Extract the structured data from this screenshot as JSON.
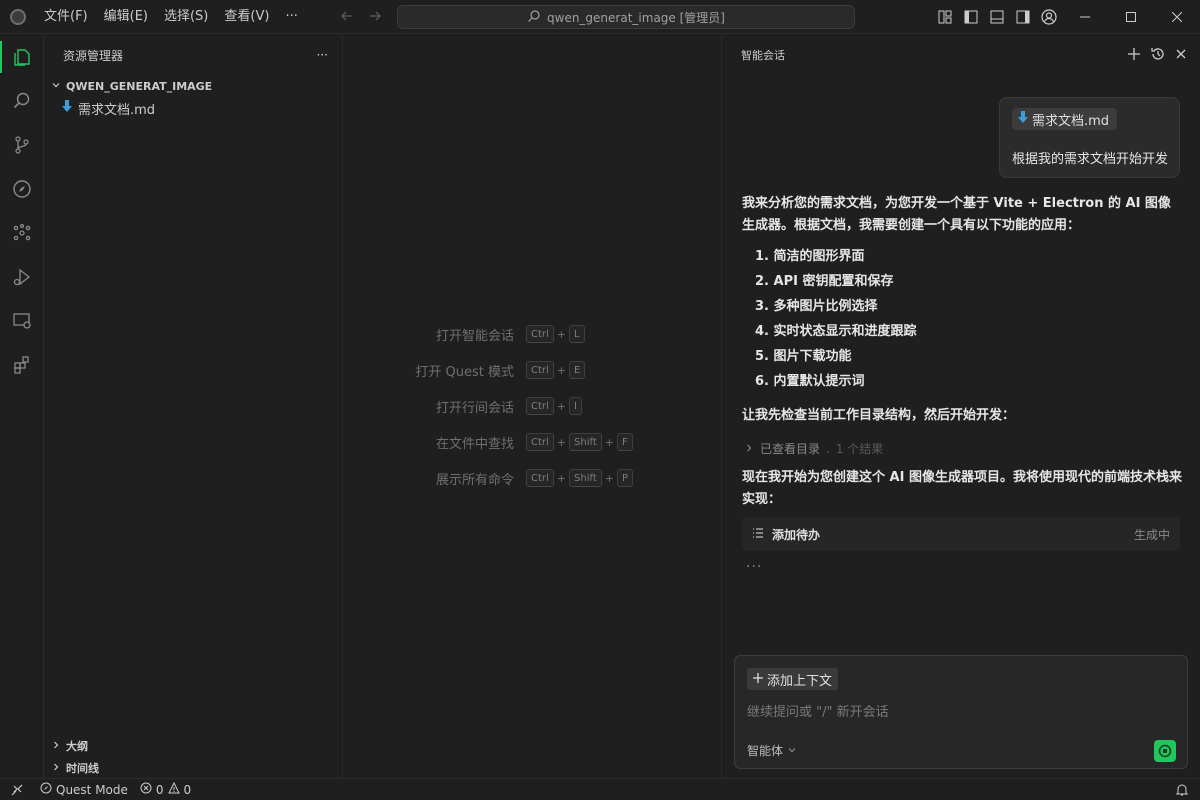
{
  "menu": [
    "文件(F)",
    "编辑(E)",
    "选择(S)",
    "查看(V)",
    "···"
  ],
  "search": {
    "text": "qwen_generat_image [管理员]"
  },
  "sidebar": {
    "title": "资源管理器",
    "more": "···",
    "folder": "QWEN_GENERAT_IMAGE",
    "files": [
      {
        "name": "需求文档.md"
      }
    ],
    "sections": [
      "大纲",
      "时间线"
    ]
  },
  "editor": {
    "shortcuts": [
      {
        "label": "打开智能会话",
        "keys": [
          "Ctrl",
          "L"
        ]
      },
      {
        "label": "打开 Quest 模式",
        "keys": [
          "Ctrl",
          "E"
        ]
      },
      {
        "label": "打开行间会话",
        "keys": [
          "Ctrl",
          "I"
        ]
      },
      {
        "label": "在文件中查找",
        "keys": [
          "Ctrl",
          "Shift",
          "F"
        ]
      },
      {
        "label": "展示所有命令",
        "keys": [
          "Ctrl",
          "Shift",
          "P"
        ]
      }
    ]
  },
  "chat": {
    "title": "智能会话",
    "user_message": {
      "file_chip": "需求文档.md",
      "text": "根据我的需求文档开始开发"
    },
    "reply_intro": "我来分析您的需求文档，为您开发一个基于 Vite + Electron 的 AI 图像生成器。根据文档，我需要创建一个具有以下功能的应用：",
    "features": [
      "1. 简洁的图形界面",
      "2. API 密钥配置和保存",
      "3. 多种图片比例选择",
      "4. 实时状态显示和进度跟踪",
      "5. 图片下载功能",
      "6. 内置默认提示词"
    ],
    "check_text": "让我先检查当前工作目录结构，然后开始开发：",
    "tool": {
      "label": "已查看目录",
      "sep": ".",
      "result": "1 个结果"
    },
    "plan_text": "现在我开始为您创建这个 AI 图像生成器项目。我将使用现代的前端技术栈来实现：",
    "todo": {
      "label": "添加待办",
      "status": "生成中"
    },
    "loading": "···",
    "input": {
      "add_context": "添加上下文",
      "placeholder": "继续提问或 \"/\" 新开会话",
      "agent": "智能体"
    }
  },
  "status": {
    "mode": "Quest Mode",
    "errors": "0",
    "warnings": "0"
  },
  "colors": {
    "accent": "#22c55e",
    "background": "#1f1f1f",
    "file_icon": "#3b9ede"
  }
}
